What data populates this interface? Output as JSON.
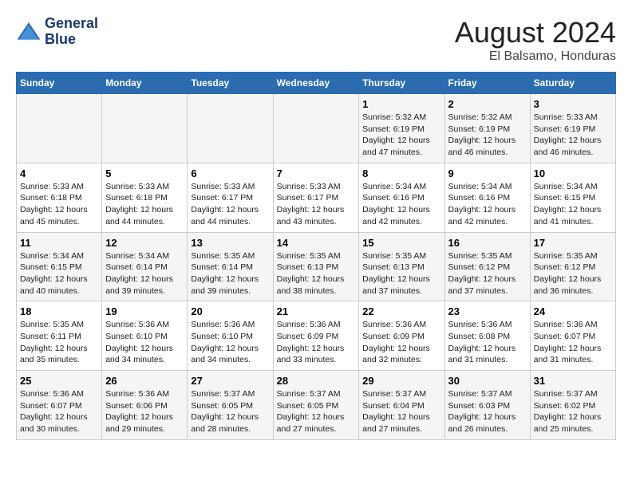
{
  "logo": {
    "line1": "General",
    "line2": "Blue"
  },
  "title": "August 2024",
  "subtitle": "El Balsamo, Honduras",
  "days_of_week": [
    "Sunday",
    "Monday",
    "Tuesday",
    "Wednesday",
    "Thursday",
    "Friday",
    "Saturday"
  ],
  "weeks": [
    [
      {
        "day": "",
        "info": ""
      },
      {
        "day": "",
        "info": ""
      },
      {
        "day": "",
        "info": ""
      },
      {
        "day": "",
        "info": ""
      },
      {
        "day": "1",
        "info": "Sunrise: 5:32 AM\nSunset: 6:19 PM\nDaylight: 12 hours\nand 47 minutes."
      },
      {
        "day": "2",
        "info": "Sunrise: 5:32 AM\nSunset: 6:19 PM\nDaylight: 12 hours\nand 46 minutes."
      },
      {
        "day": "3",
        "info": "Sunrise: 5:33 AM\nSunset: 6:19 PM\nDaylight: 12 hours\nand 46 minutes."
      }
    ],
    [
      {
        "day": "4",
        "info": "Sunrise: 5:33 AM\nSunset: 6:18 PM\nDaylight: 12 hours\nand 45 minutes."
      },
      {
        "day": "5",
        "info": "Sunrise: 5:33 AM\nSunset: 6:18 PM\nDaylight: 12 hours\nand 44 minutes."
      },
      {
        "day": "6",
        "info": "Sunrise: 5:33 AM\nSunset: 6:17 PM\nDaylight: 12 hours\nand 44 minutes."
      },
      {
        "day": "7",
        "info": "Sunrise: 5:33 AM\nSunset: 6:17 PM\nDaylight: 12 hours\nand 43 minutes."
      },
      {
        "day": "8",
        "info": "Sunrise: 5:34 AM\nSunset: 6:16 PM\nDaylight: 12 hours\nand 42 minutes."
      },
      {
        "day": "9",
        "info": "Sunrise: 5:34 AM\nSunset: 6:16 PM\nDaylight: 12 hours\nand 42 minutes."
      },
      {
        "day": "10",
        "info": "Sunrise: 5:34 AM\nSunset: 6:15 PM\nDaylight: 12 hours\nand 41 minutes."
      }
    ],
    [
      {
        "day": "11",
        "info": "Sunrise: 5:34 AM\nSunset: 6:15 PM\nDaylight: 12 hours\nand 40 minutes."
      },
      {
        "day": "12",
        "info": "Sunrise: 5:34 AM\nSunset: 6:14 PM\nDaylight: 12 hours\nand 39 minutes."
      },
      {
        "day": "13",
        "info": "Sunrise: 5:35 AM\nSunset: 6:14 PM\nDaylight: 12 hours\nand 39 minutes."
      },
      {
        "day": "14",
        "info": "Sunrise: 5:35 AM\nSunset: 6:13 PM\nDaylight: 12 hours\nand 38 minutes."
      },
      {
        "day": "15",
        "info": "Sunrise: 5:35 AM\nSunset: 6:13 PM\nDaylight: 12 hours\nand 37 minutes."
      },
      {
        "day": "16",
        "info": "Sunrise: 5:35 AM\nSunset: 6:12 PM\nDaylight: 12 hours\nand 37 minutes."
      },
      {
        "day": "17",
        "info": "Sunrise: 5:35 AM\nSunset: 6:12 PM\nDaylight: 12 hours\nand 36 minutes."
      }
    ],
    [
      {
        "day": "18",
        "info": "Sunrise: 5:35 AM\nSunset: 6:11 PM\nDaylight: 12 hours\nand 35 minutes."
      },
      {
        "day": "19",
        "info": "Sunrise: 5:36 AM\nSunset: 6:10 PM\nDaylight: 12 hours\nand 34 minutes."
      },
      {
        "day": "20",
        "info": "Sunrise: 5:36 AM\nSunset: 6:10 PM\nDaylight: 12 hours\nand 34 minutes."
      },
      {
        "day": "21",
        "info": "Sunrise: 5:36 AM\nSunset: 6:09 PM\nDaylight: 12 hours\nand 33 minutes."
      },
      {
        "day": "22",
        "info": "Sunrise: 5:36 AM\nSunset: 6:09 PM\nDaylight: 12 hours\nand 32 minutes."
      },
      {
        "day": "23",
        "info": "Sunrise: 5:36 AM\nSunset: 6:08 PM\nDaylight: 12 hours\nand 31 minutes."
      },
      {
        "day": "24",
        "info": "Sunrise: 5:36 AM\nSunset: 6:07 PM\nDaylight: 12 hours\nand 31 minutes."
      }
    ],
    [
      {
        "day": "25",
        "info": "Sunrise: 5:36 AM\nSunset: 6:07 PM\nDaylight: 12 hours\nand 30 minutes."
      },
      {
        "day": "26",
        "info": "Sunrise: 5:36 AM\nSunset: 6:06 PM\nDaylight: 12 hours\nand 29 minutes."
      },
      {
        "day": "27",
        "info": "Sunrise: 5:37 AM\nSunset: 6:05 PM\nDaylight: 12 hours\nand 28 minutes."
      },
      {
        "day": "28",
        "info": "Sunrise: 5:37 AM\nSunset: 6:05 PM\nDaylight: 12 hours\nand 27 minutes."
      },
      {
        "day": "29",
        "info": "Sunrise: 5:37 AM\nSunset: 6:04 PM\nDaylight: 12 hours\nand 27 minutes."
      },
      {
        "day": "30",
        "info": "Sunrise: 5:37 AM\nSunset: 6:03 PM\nDaylight: 12 hours\nand 26 minutes."
      },
      {
        "day": "31",
        "info": "Sunrise: 5:37 AM\nSunset: 6:02 PM\nDaylight: 12 hours\nand 25 minutes."
      }
    ]
  ]
}
